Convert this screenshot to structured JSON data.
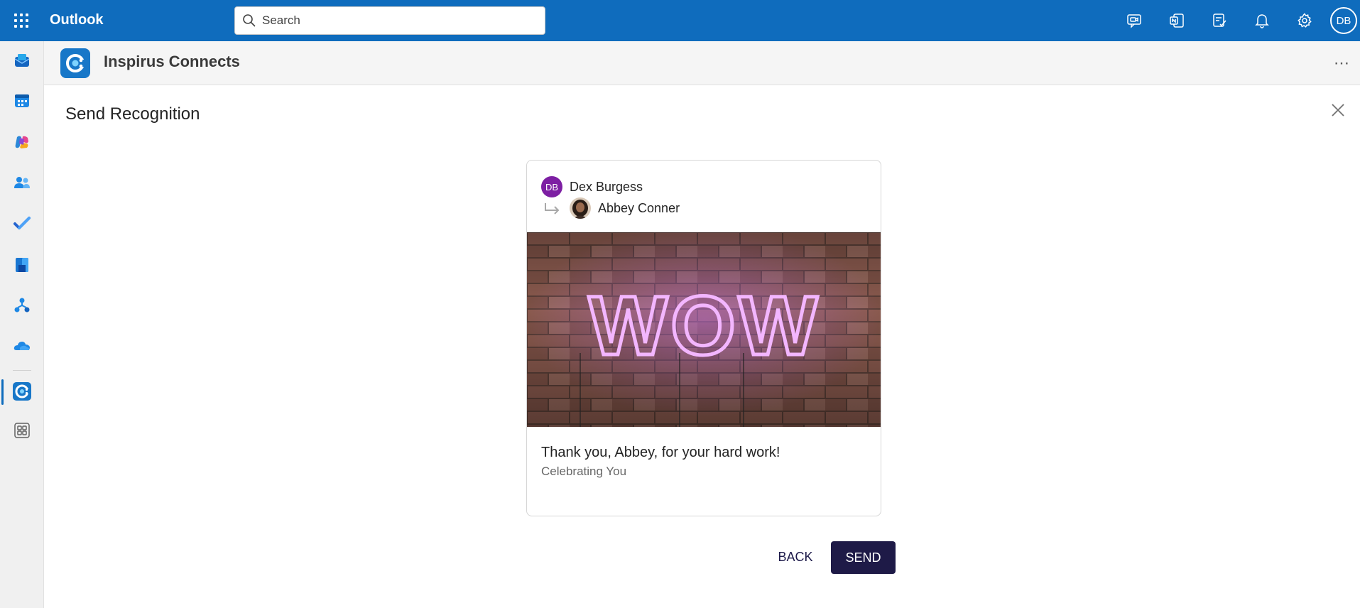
{
  "app": {
    "name": "Outlook",
    "search_placeholder": "Search",
    "user_initials": "DB"
  },
  "top_icons": [
    "meet-now-icon",
    "onenote-icon",
    "my-day-icon",
    "notification-bell-icon",
    "settings-gear-icon"
  ],
  "left_rail": [
    "mail-icon",
    "calendar-icon",
    "copilot-icon",
    "people-icon",
    "to-do-icon",
    "bookings-icon",
    "org-explorer-icon",
    "onedrive-icon",
    "inspirus-connects-icon",
    "more-apps-icon"
  ],
  "app_header": {
    "title": "Inspirus Connects",
    "more_label": "⋯"
  },
  "panel": {
    "title": "Send Recognition"
  },
  "card": {
    "sender_initials": "DB",
    "sender_name": "Dex Burgess",
    "recipient_name": "Abbey Conner",
    "banner_text": "WOW",
    "message": "Thank you, Abbey, for your hard work!",
    "category": "Celebrating You"
  },
  "actions": {
    "back_label": "BACK",
    "send_label": "SEND"
  },
  "colors": {
    "topbar": "#0f6cbd",
    "send_button": "#1e1a47",
    "sender_avatar": "#7d1fa3",
    "neon": "#f3b6ff"
  }
}
